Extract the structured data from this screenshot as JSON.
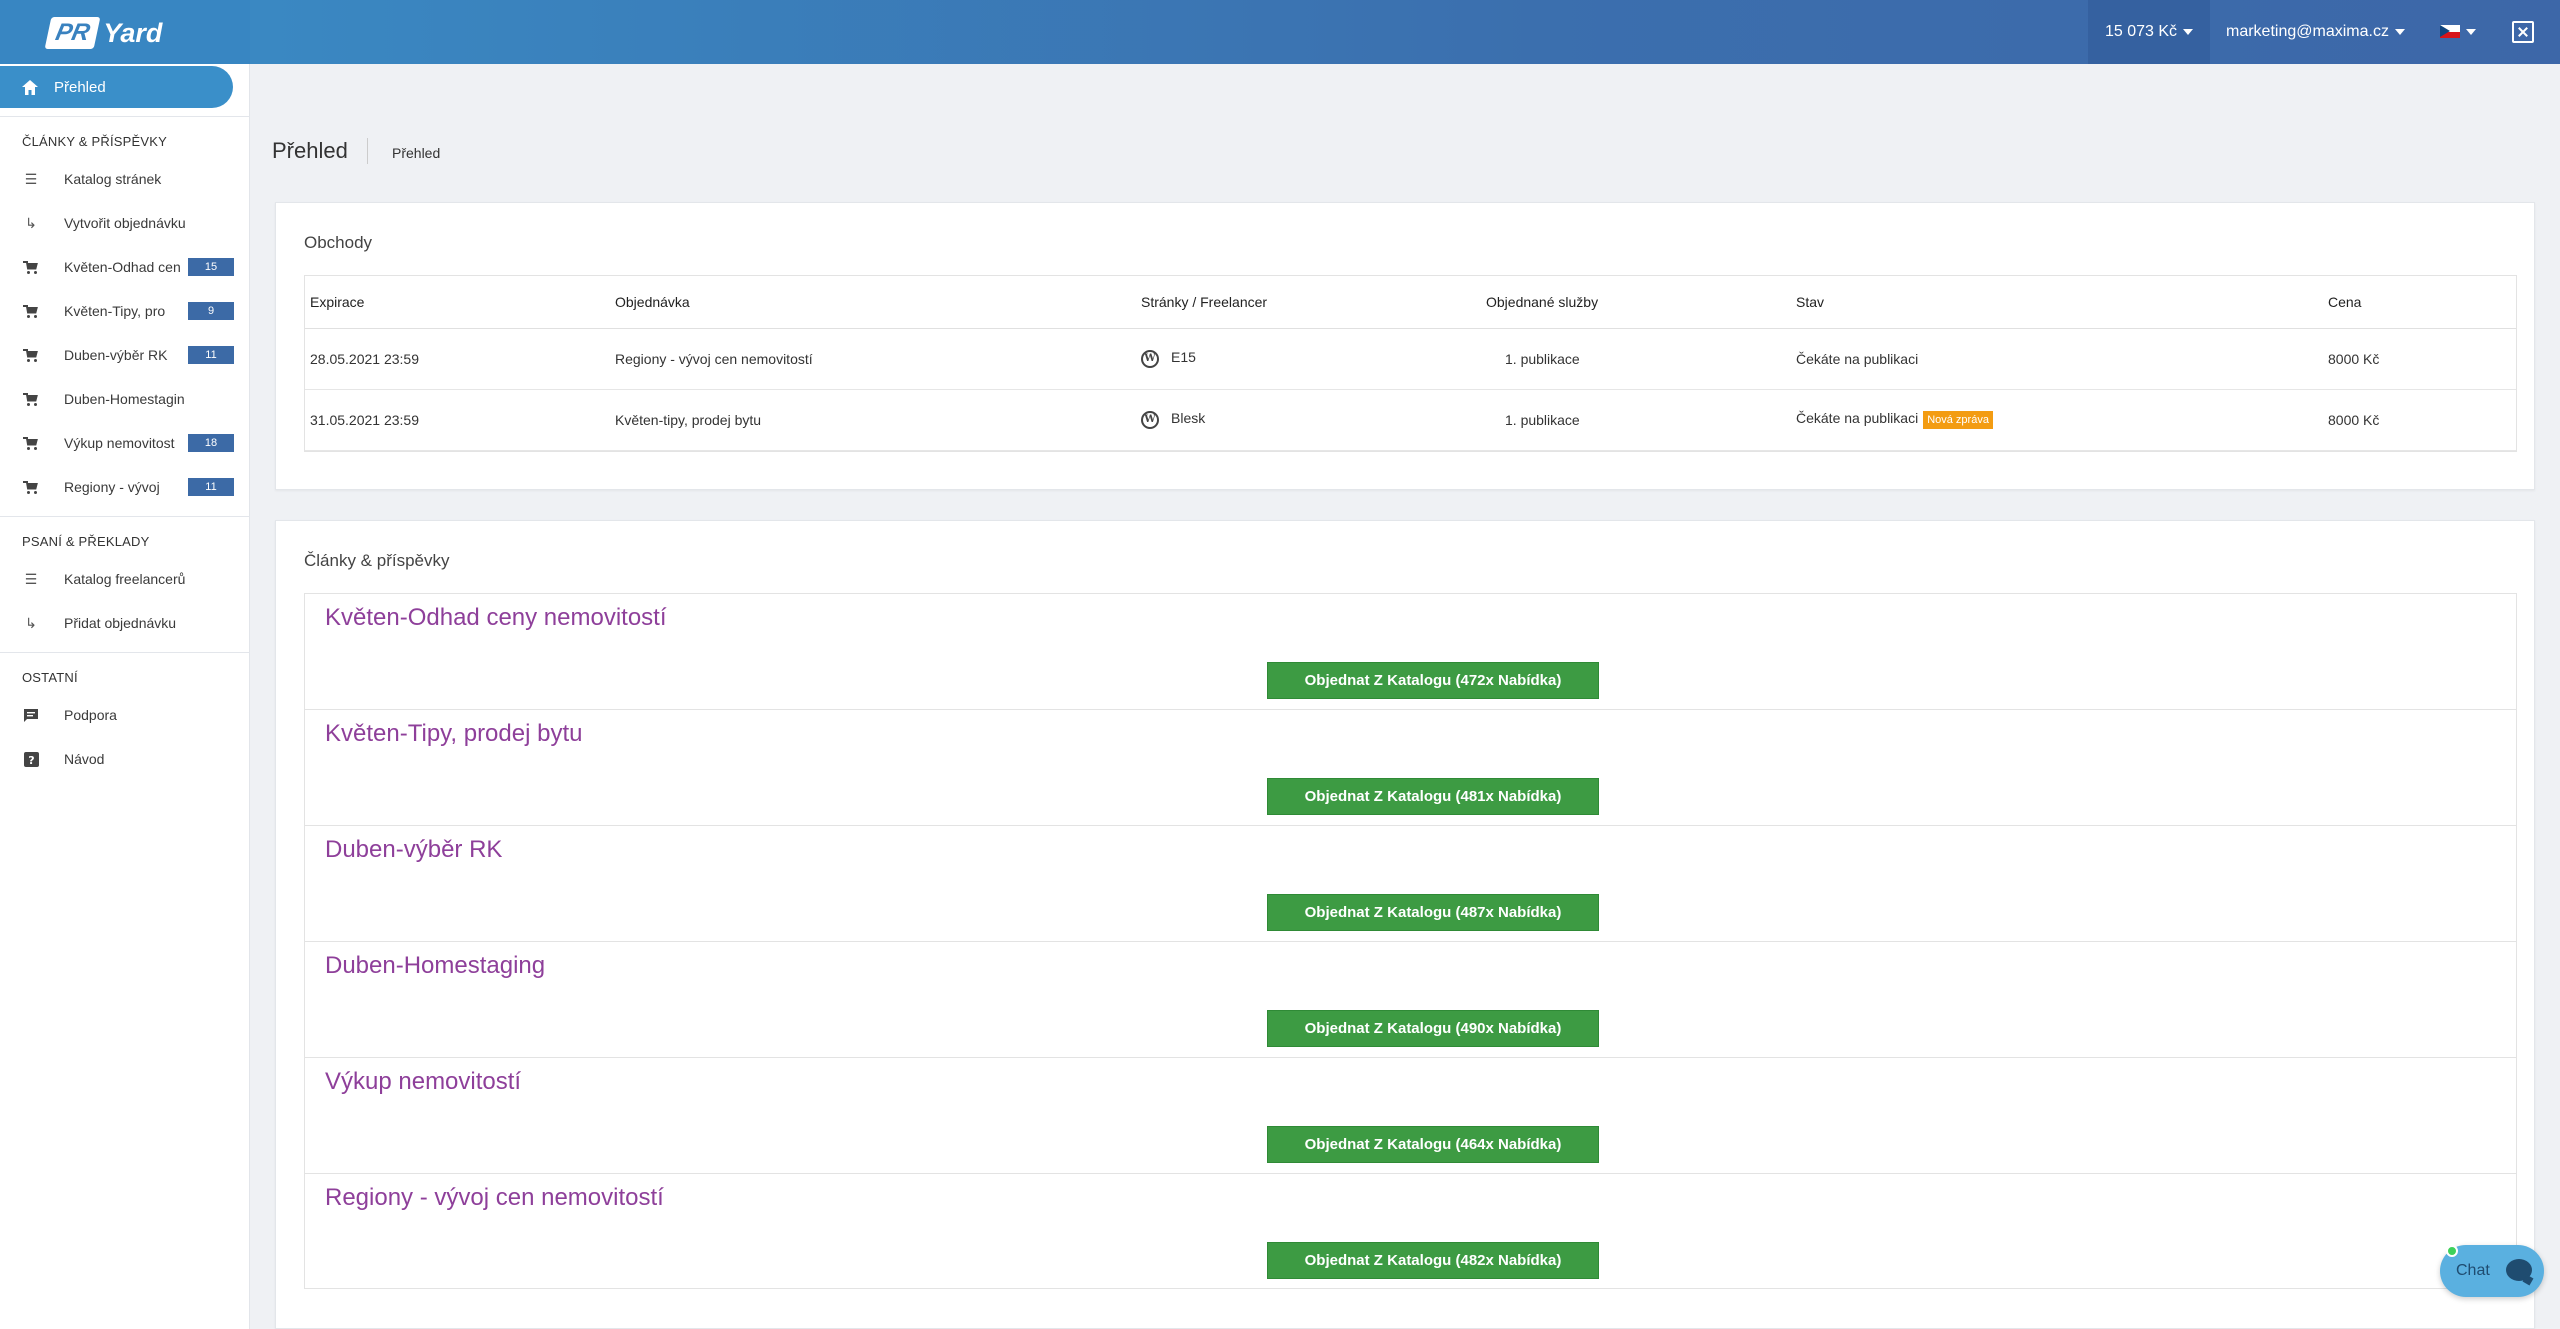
{
  "header": {
    "logo_pr": "PR",
    "logo_yard": "Yard",
    "credit": "15 073 Kč",
    "user_email": "marketing@maxima.cz",
    "language_flag": "czech-flag"
  },
  "sidebar": {
    "active_item": "Přehled",
    "sections": [
      {
        "title": "ČLÁNKY & PŘÍSPĚVKY",
        "items": [
          {
            "label": "Katalog stránek",
            "icon": "list-icon"
          },
          {
            "label": "Vytvořit objednávku",
            "icon": "subdirectory-arrow-icon"
          },
          {
            "label": "Květen-Odhad cen",
            "icon": "cart-icon",
            "badge": "15"
          },
          {
            "label": "Květen-Tipy, pro",
            "icon": "cart-icon",
            "badge": "9"
          },
          {
            "label": "Duben-výběr RK",
            "icon": "cart-icon",
            "badge": "11"
          },
          {
            "label": "Duben-Homestagin",
            "icon": "cart-icon"
          },
          {
            "label": "Výkup nemovitost",
            "icon": "cart-icon",
            "badge": "18"
          },
          {
            "label": "Regiony - vývoj",
            "icon": "cart-icon",
            "badge": "11"
          }
        ]
      },
      {
        "title": "PSANÍ & PŘEKLADY",
        "items": [
          {
            "label": "Katalog freelancerů",
            "icon": "list-icon"
          },
          {
            "label": "Přidat objednávku",
            "icon": "subdirectory-arrow-icon"
          }
        ]
      },
      {
        "title": "OSTATNÍ",
        "items": [
          {
            "label": "Podpora",
            "icon": "chat-icon"
          },
          {
            "label": "Návod",
            "icon": "help-icon"
          }
        ]
      }
    ]
  },
  "page": {
    "title": "Přehled",
    "breadcrumb": "Přehled"
  },
  "deals": {
    "title": "Obchody",
    "columns": [
      "Expirace",
      "Objednávka",
      "Stránky / Freelancer",
      "Objednané služby",
      "Stav",
      "Cena"
    ],
    "rows": [
      {
        "expirace": "28.05.2021 23:59",
        "objednavka": "Regiony - vývoj cen nemovitostí",
        "site": "E15",
        "sluzby": "1. publikace",
        "stav": "Čekáte na publikaci",
        "badge": "",
        "cena": "8000 Kč"
      },
      {
        "expirace": "31.05.2021 23:59",
        "objednavka": "Květen-tipy, prodej bytu",
        "site": "Blesk",
        "sluzby": "1. publikace",
        "stav": "Čekáte na publikaci",
        "badge": "Nová zpráva",
        "cena": "8000 Kč"
      }
    ]
  },
  "articles": {
    "title": "Články & příspěvky",
    "items": [
      {
        "title": "Květen-Odhad ceny nemovitostí",
        "button": "Objednat Z Katalogu (472x Nabídka)"
      },
      {
        "title": "Květen-Tipy, prodej bytu",
        "button": "Objednat Z Katalogu (481x Nabídka)"
      },
      {
        "title": "Duben-výběr RK",
        "button": "Objednat Z Katalogu (487x Nabídka)"
      },
      {
        "title": "Duben-Homestaging",
        "button": "Objednat Z Katalogu (490x Nabídka)"
      },
      {
        "title": "Výkup nemovitostí",
        "button": "Objednat Z Katalogu (464x Nabídka)"
      },
      {
        "title": "Regiony - vývoj cen nemovitostí",
        "button": "Objednat Z Katalogu (482x Nabídka)"
      }
    ]
  },
  "chat": {
    "label": "Chat"
  },
  "colors": {
    "accent": "#3a8fc9",
    "button": "#3d9b43",
    "article_title": "#8e3f9a",
    "badge": "#3c6aa6",
    "new_badge": "#f39c12"
  }
}
